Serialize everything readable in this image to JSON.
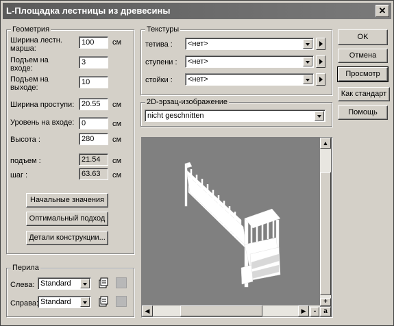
{
  "window": {
    "title": "L-Площадка лестницы из древесины",
    "close": "✕"
  },
  "geometry": {
    "title": "Геометрия",
    "fields": [
      {
        "label": "Ширина лестн. марша:",
        "value": "100",
        "unit": "см"
      },
      {
        "label": "Подъем на входе:",
        "value": "3",
        "unit": ""
      },
      {
        "label": "Подъем на выходе:",
        "value": "10",
        "unit": ""
      },
      {
        "label": "Ширина проступи:",
        "value": "20.55",
        "unit": "см"
      },
      {
        "label": "Уровень на входе:",
        "value": "0",
        "unit": "см"
      },
      {
        "label": "Высота :",
        "value": "280",
        "unit": "см"
      },
      {
        "label": "подъем :",
        "value": "21.54",
        "unit": "см"
      },
      {
        "label": "шаг :",
        "value": "63.63",
        "unit": "см"
      }
    ],
    "buttons": [
      "Начальные значения",
      "Оптимальный подход",
      "Детали конструкции..."
    ]
  },
  "railings": {
    "title": "Перила",
    "left": {
      "label": "Слева:",
      "value": "Standard"
    },
    "right": {
      "label": "Справа:",
      "value": "Standard"
    }
  },
  "textures": {
    "title": "Текстуры",
    "rows": [
      {
        "label": "тетива :",
        "value": "<нет>"
      },
      {
        "label": "ступени :",
        "value": "<нет>"
      },
      {
        "label": "стойки :",
        "value": "<нет>"
      }
    ]
  },
  "substitute": {
    "title": "2D-эрзац-изображение",
    "value": "nicht geschnitten"
  },
  "actions": {
    "ok": "OK",
    "cancel": "Отмена",
    "preview": "Просмотр",
    "default": "Как стандарт",
    "help": "Помощь"
  },
  "scroll": {
    "plus": "+",
    "minus": "-",
    "a": "a"
  },
  "colors": {
    "title_gradient_start": "#5a5a5a",
    "preview_bg": "#808080",
    "stairs": "#ffffff"
  }
}
